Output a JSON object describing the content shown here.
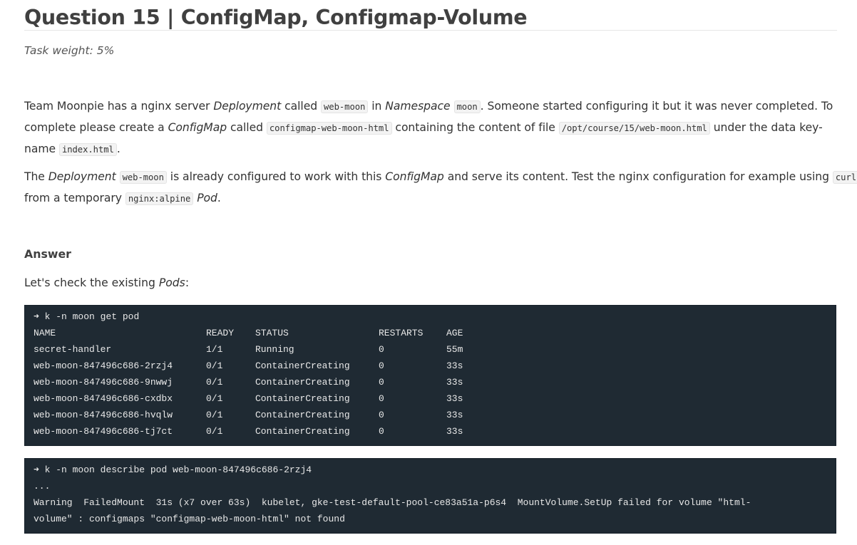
{
  "heading": "Question 15 | ConfigMap, Configmap-Volume",
  "task_weight": "Task weight: 5%",
  "para1": {
    "l1_a": "Team Moonpie has a nginx server ",
    "l1_b": "Deployment",
    "l1_c": " called ",
    "l1_code1": "web-moon",
    "l1_d": " in ",
    "l1_e": "Namespace",
    "l1_f": " ",
    "l1_code2": "moon",
    "l1_g": ". Someone started configuring it but it was never completed. To",
    "l2_a": "complete please create a ",
    "l2_b": "ConfigMap",
    "l2_c": " called ",
    "l2_code1": "configmap-web-moon-html",
    "l2_d": " containing the content of file ",
    "l2_code2": "/opt/course/15/web-moon.html",
    "l2_e": " under the data key-",
    "l3_a": "name ",
    "l3_code": "index.html",
    "l3_b": "."
  },
  "para2": {
    "l1_a": "The ",
    "l1_b": "Deployment",
    "l1_c": " ",
    "l1_code1": "web-moon",
    "l1_d": " is already configured to work with this ",
    "l1_e": "ConfigMap",
    "l1_f": " and serve its content. Test the nginx configuration for example using ",
    "l1_code2": "curl",
    "l2_a": "from a temporary ",
    "l2_code": "nginx:alpine",
    "l2_b": " ",
    "l2_c": "Pod",
    "l2_d": "."
  },
  "answer_heading": "Answer",
  "check_text": {
    "a": "Let's check the existing ",
    "b": "Pods",
    "c": ":"
  },
  "code1": {
    "command": "➜ k -n moon get pod",
    "headers": [
      "NAME",
      "READY",
      "STATUS",
      "RESTARTS",
      "AGE"
    ],
    "rows": [
      [
        "secret-handler",
        "1/1",
        "Running",
        "0",
        "55m"
      ],
      [
        "web-moon-847496c686-2rzj4",
        "0/1",
        "ContainerCreating",
        "0",
        "33s"
      ],
      [
        "web-moon-847496c686-9nwwj",
        "0/1",
        "ContainerCreating",
        "0",
        "33s"
      ],
      [
        "web-moon-847496c686-cxdbx",
        "0/1",
        "ContainerCreating",
        "0",
        "33s"
      ],
      [
        "web-moon-847496c686-hvqlw",
        "0/1",
        "ContainerCreating",
        "0",
        "33s"
      ],
      [
        "web-moon-847496c686-tj7ct",
        "0/1",
        "ContainerCreating",
        "0",
        "33s"
      ]
    ]
  },
  "code2": {
    "lines": [
      "➜ k -n moon describe pod web-moon-847496c686-2rzj4",
      "...",
      "Warning  FailedMount  31s (x7 over 63s)  kubelet, gke-test-default-pool-ce83a51a-p6s4  MountVolume.SetUp failed for volume \"html-",
      "volume\" : configmaps \"configmap-web-moon-html\" not found"
    ]
  }
}
